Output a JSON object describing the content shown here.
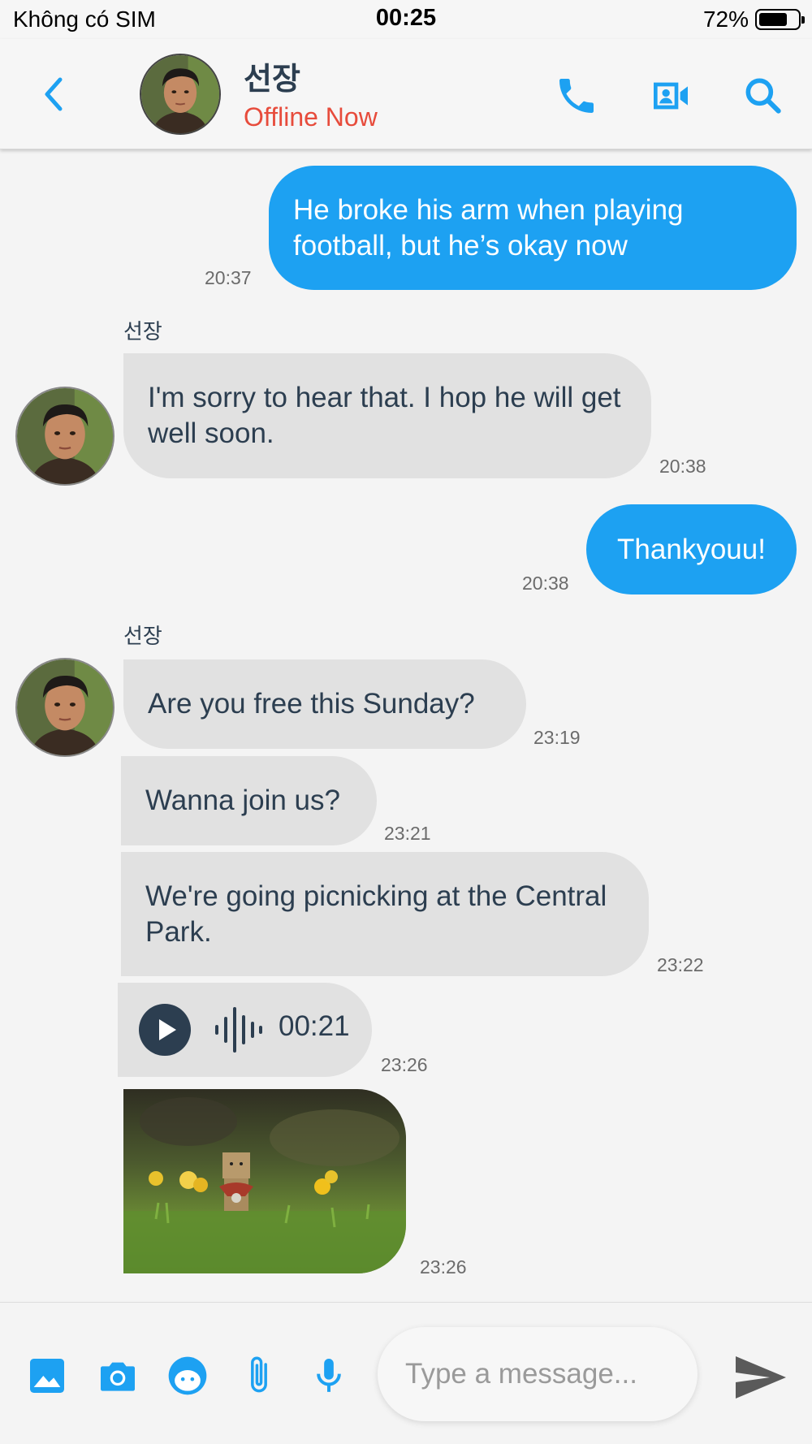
{
  "status_bar": {
    "carrier": "Không có SIM",
    "time": "00:25",
    "battery": "72%"
  },
  "header": {
    "contact_name": "선장",
    "contact_status": "Offline Now",
    "status_color": "#e74c3c"
  },
  "colors": {
    "accent": "#1da1f2",
    "incoming_bubble": "#e1e1e1",
    "text_dark": "#2c3e50"
  },
  "messages": [
    {
      "dir": "out",
      "text": "He broke his arm when playing football, but he’s okay now",
      "time": "20:37"
    },
    {
      "dir": "in",
      "sender": "선장",
      "text": "I'm sorry to hear that. I hop he will get well soon.",
      "time": "20:38"
    },
    {
      "dir": "out",
      "text": "Thankyouu!",
      "time": "20:38"
    },
    {
      "dir": "in",
      "sender": "선장",
      "text": "Are you free this Sunday?",
      "time": "23:19"
    },
    {
      "dir": "in",
      "text": "Wanna join us?",
      "time": "23:21"
    },
    {
      "dir": "in",
      "text": "We're going picnicking at the Central Park.",
      "time": "23:22"
    },
    {
      "dir": "in",
      "type": "voice",
      "duration": "00:21",
      "time": "23:26"
    },
    {
      "dir": "in",
      "type": "image",
      "time": "23:26"
    }
  ],
  "composer": {
    "placeholder": "Type a message...",
    "tools": [
      "image-icon",
      "camera-icon",
      "sticker-icon",
      "attach-icon",
      "mic-icon"
    ],
    "send_icon": "send-icon"
  }
}
